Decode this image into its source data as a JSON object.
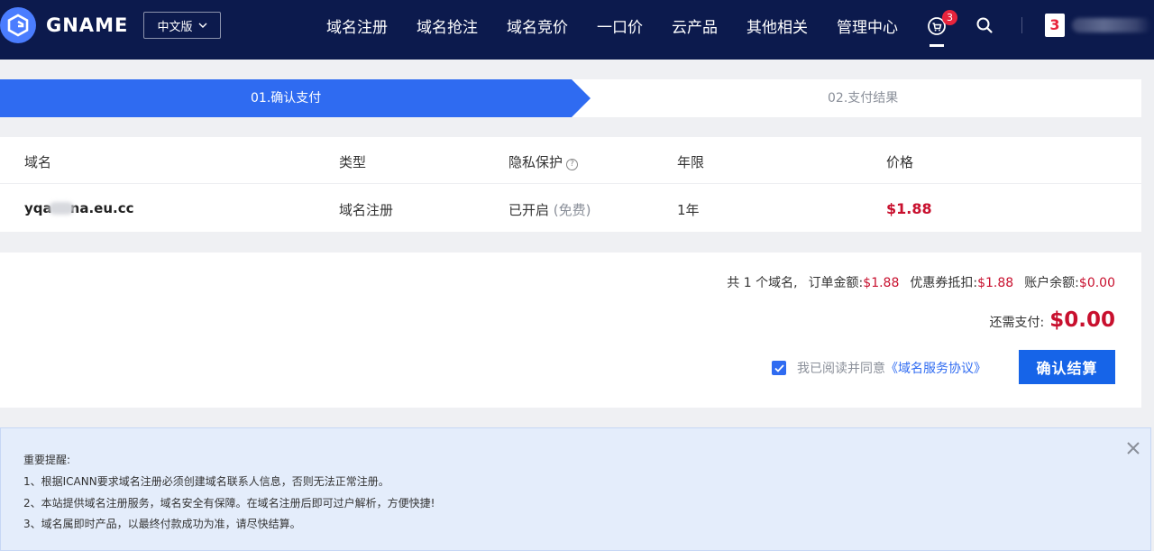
{
  "header": {
    "brand": "GNAME",
    "lang_label": "中文版",
    "nav": [
      "域名注册",
      "域名抢注",
      "域名竞价",
      "一口价",
      "云产品",
      "其他相关",
      "管理中心"
    ],
    "cart_count": "3",
    "avatar_label": "3"
  },
  "steps": {
    "step1": "01.确认支付",
    "step2": "02.支付结果"
  },
  "table": {
    "headers": [
      "域名",
      "类型",
      "隐私保护",
      "年限",
      "价格"
    ],
    "help_icon_glyph": "?",
    "row": {
      "domain_prefix": "yqa",
      "domain_suffix": "na.eu.cc",
      "type": "域名注册",
      "privacy_status": "已开启",
      "privacy_note": "(免费)",
      "years": "1年",
      "price": "$1.88"
    }
  },
  "summary": {
    "count_text": "共 1 个域名,",
    "order_label": "订单金额:",
    "order_amount": "$1.88",
    "coupon_label": "优惠券抵扣:",
    "coupon_amount": "$1.88",
    "balance_label": "账户余额:",
    "balance_amount": "$0.00",
    "pay_label": "还需支付:",
    "pay_amount": "$0.00",
    "agree_text": "我已阅读并同意",
    "agree_link": "《域名服务协议》",
    "confirm_label": "确认结算"
  },
  "notice": {
    "title": "重要提醒:",
    "lines": [
      "1、根据ICANN要求域名注册必须创建域名联系人信息，否则无法正常注册。",
      "2、本站提供域名注册服务，域名安全有保障。在域名注册后即可过户解析，方便快捷!",
      "3、域名属即时产品，以最终付款成功为准，请尽快结算。"
    ]
  },
  "colors": {
    "header_bg": "#0c1a4d",
    "accent": "#2f6bf1",
    "price_red": "#c8102e"
  }
}
